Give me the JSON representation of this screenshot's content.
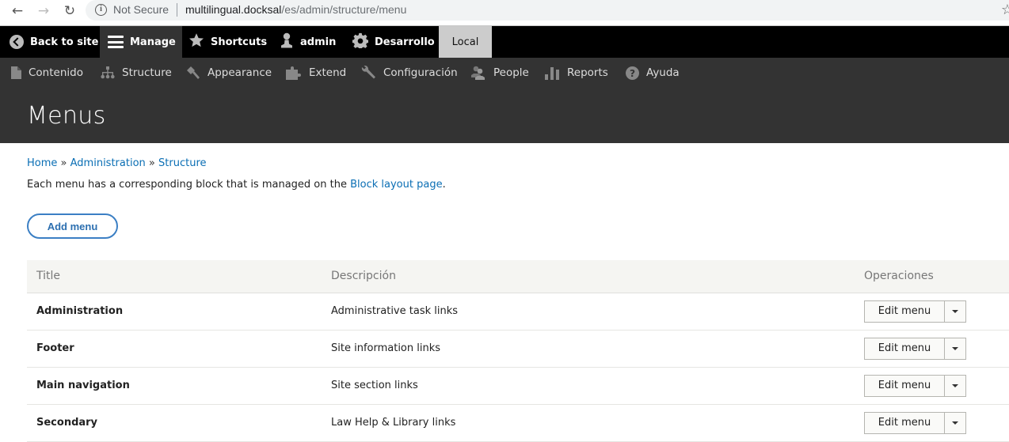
{
  "browser": {
    "security_label": "Not Secure",
    "url_host": "multilingual.docksal",
    "url_path": "/es/admin/structure/menu"
  },
  "toolbar": {
    "items": [
      {
        "label": "Back to site",
        "icon": "back-circle-icon"
      },
      {
        "label": "Manage",
        "icon": "hamburger-icon",
        "active": true
      },
      {
        "label": "Shortcuts",
        "icon": "star-icon"
      },
      {
        "label": "admin",
        "icon": "user-icon"
      },
      {
        "label": "Desarrollo",
        "icon": "gear-icon"
      },
      {
        "label": "Local",
        "icon": null
      }
    ]
  },
  "tray": {
    "items": [
      {
        "label": "Contenido",
        "icon": "document-icon"
      },
      {
        "label": "Structure",
        "icon": "sitemap-icon"
      },
      {
        "label": "Appearance",
        "icon": "paintbrush-icon"
      },
      {
        "label": "Extend",
        "icon": "puzzle-icon"
      },
      {
        "label": "Configuración",
        "icon": "wrench-icon"
      },
      {
        "label": "People",
        "icon": "people-icon"
      },
      {
        "label": "Reports",
        "icon": "bar-chart-icon"
      },
      {
        "label": "Ayuda",
        "icon": "help-icon"
      }
    ]
  },
  "page": {
    "title": "Menus",
    "breadcrumb": [
      "Home",
      "Administration",
      "Structure"
    ],
    "breadcrumb_sep": "»",
    "help_prefix": "Each menu has a corresponding block that is managed on the ",
    "help_link": "Block layout page",
    "help_suffix": ".",
    "add_button": "Add menu"
  },
  "table": {
    "headers": [
      "Title",
      "Descripción",
      "Operaciones"
    ],
    "rows": [
      {
        "title": "Administration",
        "description": "Administrative task links",
        "operation": "Edit menu"
      },
      {
        "title": "Footer",
        "description": "Site information links",
        "operation": "Edit menu"
      },
      {
        "title": "Main navigation",
        "description": "Site section links",
        "operation": "Edit menu"
      },
      {
        "title": "Secondary",
        "description": "Law Help & Library links",
        "operation": "Edit menu"
      }
    ]
  },
  "colors": {
    "link": "#0a6eb4",
    "toolbar_bg": "#000000",
    "tray_bg": "#333333",
    "local_env_bg": "#cccccc"
  }
}
